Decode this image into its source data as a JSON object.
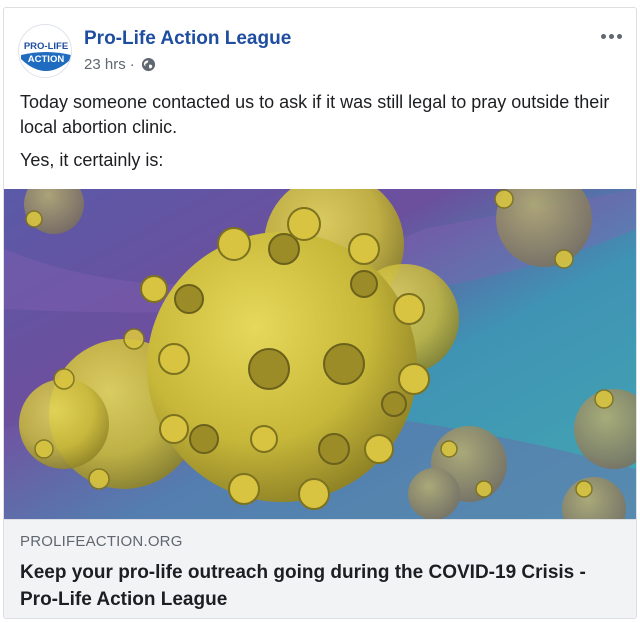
{
  "post": {
    "page_name": "Pro-Life Action League",
    "avatar_text_top": "PRO-LIFE",
    "avatar_text_bottom": "ACTION",
    "time": "23 hrs",
    "separator": "·",
    "privacy_icon": "globe-icon",
    "more_icon": "more-options-icon",
    "text_paragraphs": [
      "Today someone contacted us to ask if it was still legal to pray outside their local abortion clinic.",
      "Yes, it certainly is:"
    ],
    "image_subject": "coronavirus-illustration",
    "link": {
      "domain": "PROLIFEACTION.ORG",
      "title": "Keep your pro-life outreach going during the COVID-19 Crisis - Pro-Life Action League"
    }
  },
  "colors": {
    "brand_blue": "#1f4ea1",
    "meta_gray": "#606770",
    "link_bg": "#f2f3f5",
    "virus_yellow": "#d8c440",
    "background_teal": "#3aa3b0",
    "background_purple": "#6c4f9d"
  }
}
